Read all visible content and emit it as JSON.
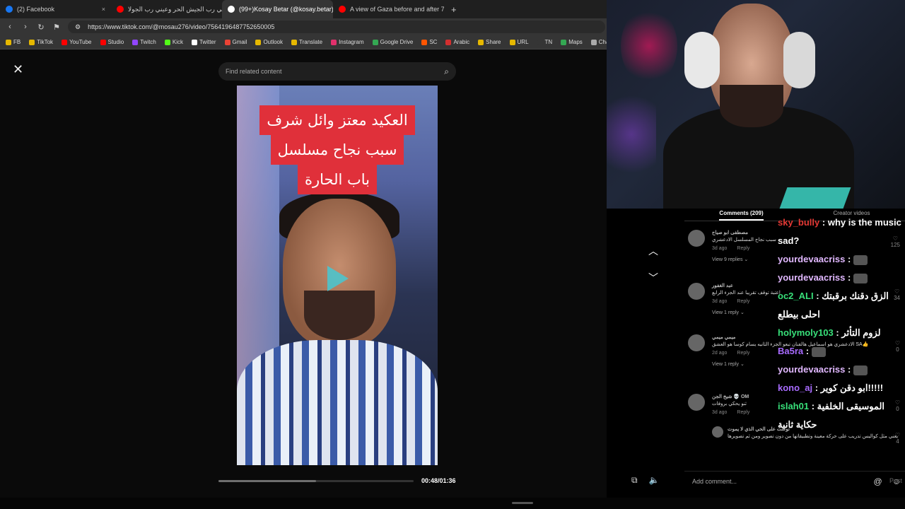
{
  "browser": {
    "tabs": [
      {
        "label": "(2) Facebook",
        "color": "#1877f2"
      },
      {
        "label": "عيني رب الجيش الحر وعيني رب الجولا...",
        "color": "#ff0000"
      },
      {
        "label": "(99+)Kosay Betar (@kosay.betar)",
        "color": "#ffffff",
        "active": true
      },
      {
        "label": "A view of Gaza before and after 7 Oc",
        "color": "#ff0000"
      }
    ],
    "new_tab": "+",
    "close_tab": "×",
    "url": "https://www.tiktok.com/@mosau276/video/7564196487752650005",
    "bookmarks": [
      {
        "label": "FB",
        "color": "#e6b800"
      },
      {
        "label": "TikTok",
        "color": "#e6b800"
      },
      {
        "label": "YouTube",
        "color": "#ff0000"
      },
      {
        "label": "Studio",
        "color": "#ff0000"
      },
      {
        "label": "Twitch",
        "color": "#9146ff"
      },
      {
        "label": "Kick",
        "color": "#53fc18"
      },
      {
        "label": "Twitter",
        "color": "#ffffff"
      },
      {
        "label": "Gmail",
        "color": "#ea4335"
      },
      {
        "label": "Outlook",
        "color": "#e6b800"
      },
      {
        "label": "Translate",
        "color": "#e6b800"
      },
      {
        "label": "Instagram",
        "color": "#e1306c"
      },
      {
        "label": "Google Drive",
        "color": "#34a853"
      },
      {
        "label": "SC",
        "color": "#ff5500"
      },
      {
        "label": "Arabic",
        "color": "#d32f2f"
      },
      {
        "label": "Share",
        "color": "#e6b800"
      },
      {
        "label": "URL",
        "color": "#e6b800"
      },
      {
        "label": "TN",
        "color": "#353535"
      },
      {
        "label": "Maps",
        "color": "#34a853"
      },
      {
        "label": "Chat",
        "color": "#aaaaaa"
      }
    ]
  },
  "viewer": {
    "close": "✕",
    "search_placeholder": "Find related content",
    "search_icon": "⌕",
    "caption_lines": [
      "العكيد معتز وائل شرف",
      "سبب نجاح مسلسل",
      "باب الحارة"
    ],
    "progress_fraction": 0.5,
    "time": "00:48/01:36",
    "up_arrow": "︿",
    "down_arrow": "﹀"
  },
  "comments": {
    "tab_comments": "Comments (209)",
    "tab_creator": "Creator videos",
    "items": [
      {
        "name": "مصطفى ابو صياح",
        "text": "سبب نجاح المسلسل الادعشري",
        "age": "3d ago",
        "reply": "Reply",
        "replies": "View 9 replies ⌄",
        "likes": "125"
      },
      {
        "name": "عبد الغفور",
        "text": "اعتبة توقف تقريبا عند الجزء الرابع",
        "age": "3d ago",
        "reply": "Reply",
        "replies": "View 1 reply ⌄",
        "likes": "34"
      },
      {
        "name": "ميمي ميمي",
        "text": "الادعشري هو اسماعيل هالفنان تبعو الجزء الثانيه يسام كوسا هو العشق SA👍",
        "age": "2d ago",
        "reply": "Reply",
        "replies": "View 1 reply ⌄",
        "likes": "0"
      },
      {
        "name": "شيخ الجن 💀 OM",
        "text": "ثنو يحكي بروفات",
        "age": "3d ago",
        "reply": "Reply",
        "replies": "",
        "likes": "0"
      },
      {
        "name": "توكلت على الحي الذي لا يموت",
        "text": "يعني مثل كواليس تدريب على حركة معينة وتطبيقاتها من دون تصوير ومن ثم تصويرها",
        "age": "",
        "reply": "",
        "replies": "",
        "likes": "4"
      }
    ],
    "add_placeholder": "Add comment...",
    "at_icon": "@",
    "emoji_icon": "☺",
    "post": "Post"
  },
  "chat": [
    {
      "user": "sky_bully",
      "sep": " : ",
      "msg": "why is the music sad?",
      "color": "#e53935"
    },
    {
      "user": "yourdevaacriss",
      "sep": " : ",
      "msg": "",
      "color": "#e1b8ff",
      "emote": true
    },
    {
      "user": "yourdevaacriss",
      "sep": " : ",
      "msg": "",
      "color": "#e1b8ff",
      "emote": true
    },
    {
      "user": "oc2_ALI",
      "sep": " : ",
      "msg": "الزق دقنك برقبتك احلى بيطلع",
      "color": "#38e07a"
    },
    {
      "user": "holymoly103",
      "sep": " : ",
      "msg": "لزوم التأثر",
      "color": "#38e07a"
    },
    {
      "user": "Ba5ra",
      "sep": " : ",
      "msg": "",
      "color": "#a86bff",
      "emote": true
    },
    {
      "user": "yourdevaacriss",
      "sep": " : ",
      "msg": "",
      "color": "#e1b8ff",
      "emote": true
    },
    {
      "user": "kono_aj",
      "sep": " : ",
      "msg": "ابو دقن كوير!!!!!",
      "color": "#a86bff"
    },
    {
      "user": "islah01",
      "sep": " : ",
      "msg": "الموسيقى الخلفية حكاية ثانية",
      "color": "#38e07a"
    }
  ]
}
